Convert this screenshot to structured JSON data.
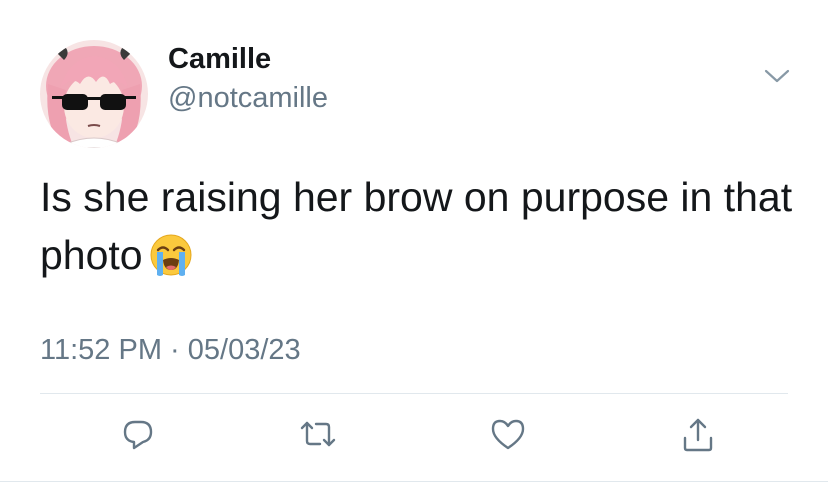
{
  "author": {
    "display_name": "Camille",
    "handle": "@notcamille",
    "avatar_icon": "anime-avatar-sunglasses"
  },
  "tweet": {
    "text": "Is she raising her brow on purpose in that photo",
    "emoji": "loudly-crying-face-emoji",
    "time": "11:52 PM",
    "separator": "·",
    "date": "05/03/23"
  },
  "actions": [
    {
      "name": "reply",
      "icon": "reply-icon"
    },
    {
      "name": "retweet",
      "icon": "retweet-icon"
    },
    {
      "name": "like",
      "icon": "heart-icon"
    },
    {
      "name": "share",
      "icon": "share-icon"
    }
  ],
  "colors": {
    "text_primary": "#14171a",
    "text_secondary": "#657786",
    "icon": "#657786",
    "divider": "#e1e8ed"
  }
}
